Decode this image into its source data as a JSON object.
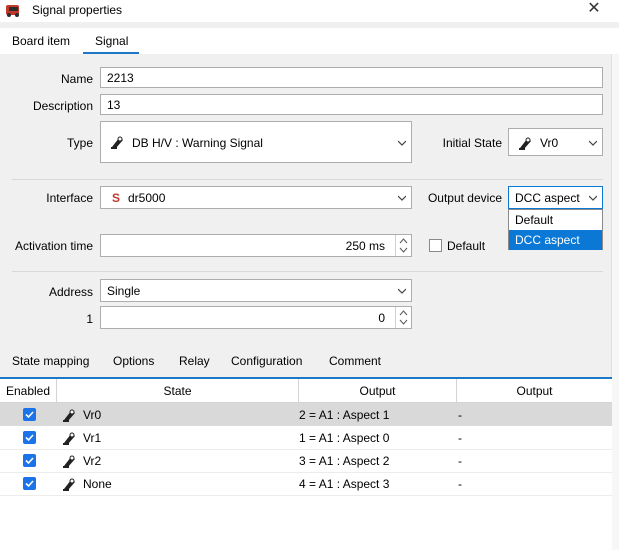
{
  "window": {
    "title": "Signal properties"
  },
  "tabs_top": [
    {
      "label": "Board item"
    },
    {
      "label": "Signal"
    }
  ],
  "form": {
    "name_label": "Name",
    "name_value": "2213",
    "description_label": "Description",
    "description_value": "13",
    "type_label": "Type",
    "type_value": "DB H/V : Warning Signal",
    "initial_state_label": "Initial State",
    "initial_state_value": "Vr0",
    "interface_label": "Interface",
    "interface_icon": "S",
    "interface_value": "dr5000",
    "output_device_label": "Output device",
    "output_device_value": "DCC aspect",
    "activation_time_label": "Activation time",
    "activation_time_value": "250 ms",
    "default_label": "Default",
    "address_label": "Address",
    "address_value": "Single",
    "address_index_label": "1",
    "address_index_value": "0"
  },
  "dropdown": {
    "options": [
      "Default",
      "DCC aspect"
    ],
    "selected": "DCC aspect"
  },
  "tabs_bottom": [
    {
      "label": "State mapping"
    },
    {
      "label": "Options"
    },
    {
      "label": "Relay"
    },
    {
      "label": "Configuration"
    },
    {
      "label": "Comment"
    }
  ],
  "table": {
    "headers": [
      "Enabled",
      "State",
      "Output",
      "Output"
    ],
    "rows": [
      {
        "state": "Vr0",
        "output1": "2 = A1 : Aspect 1",
        "output2": "-"
      },
      {
        "state": "Vr1",
        "output1": "1 = A1 : Aspect 0",
        "output2": "-"
      },
      {
        "state": "Vr2",
        "output1": "3 = A1 : Aspect 2",
        "output2": "-"
      },
      {
        "state": "None",
        "output1": "4 = A1 : Aspect 3",
        "output2": "-"
      }
    ]
  },
  "colors": {
    "accent": "#1e78c8",
    "checkbox": "#1a73e8",
    "selected_option": "#0a78d4",
    "interface_icon": "#c0392b"
  }
}
